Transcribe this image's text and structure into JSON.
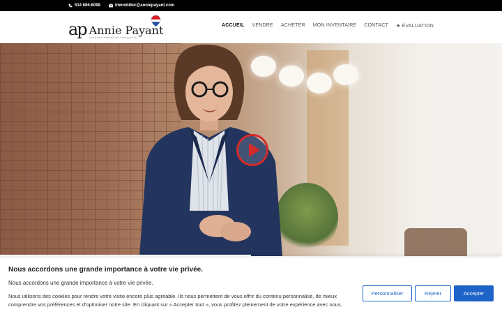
{
  "topbar": {
    "phone": "514 686-8098",
    "email": "immobilier@anniepayant.com"
  },
  "logo": {
    "monogram": "ap",
    "name": "Annie Payant",
    "tagline": "COURTIER IMMOBILIER RÉSIDENTIEL"
  },
  "nav": {
    "items": [
      {
        "label": "ACCUEIL"
      },
      {
        "label": "VENDRE"
      },
      {
        "label": "ACHETER"
      },
      {
        "label": "MON INVENTAIRE"
      },
      {
        "label": "CONTACT"
      },
      {
        "label": "★ ÉVALUATION"
      }
    ]
  },
  "hero": {
    "play_icon": "play-icon"
  },
  "cookie": {
    "title": "Nous accordons une grande importance à votre vie privée.",
    "subtitle": "Nous accordons une grande importance à votre vie privée.",
    "body": "Nous utilisons des cookies pour rendre votre visite encore plus agréable. Ils nous permettent de vous offrir du contenu personnalisé, de mieux comprendre vos préférences et d'optimiser notre site. En cliquant sur « Accepter tout », vous profitez pleinement de votre expérience avec nous.",
    "customize_label": "Personnaliser",
    "reject_label": "Rejeter",
    "accept_label": "Accepter"
  },
  "colors": {
    "accent": "#1e63c7",
    "play": "#d42a2a",
    "topbar": "#000000"
  }
}
